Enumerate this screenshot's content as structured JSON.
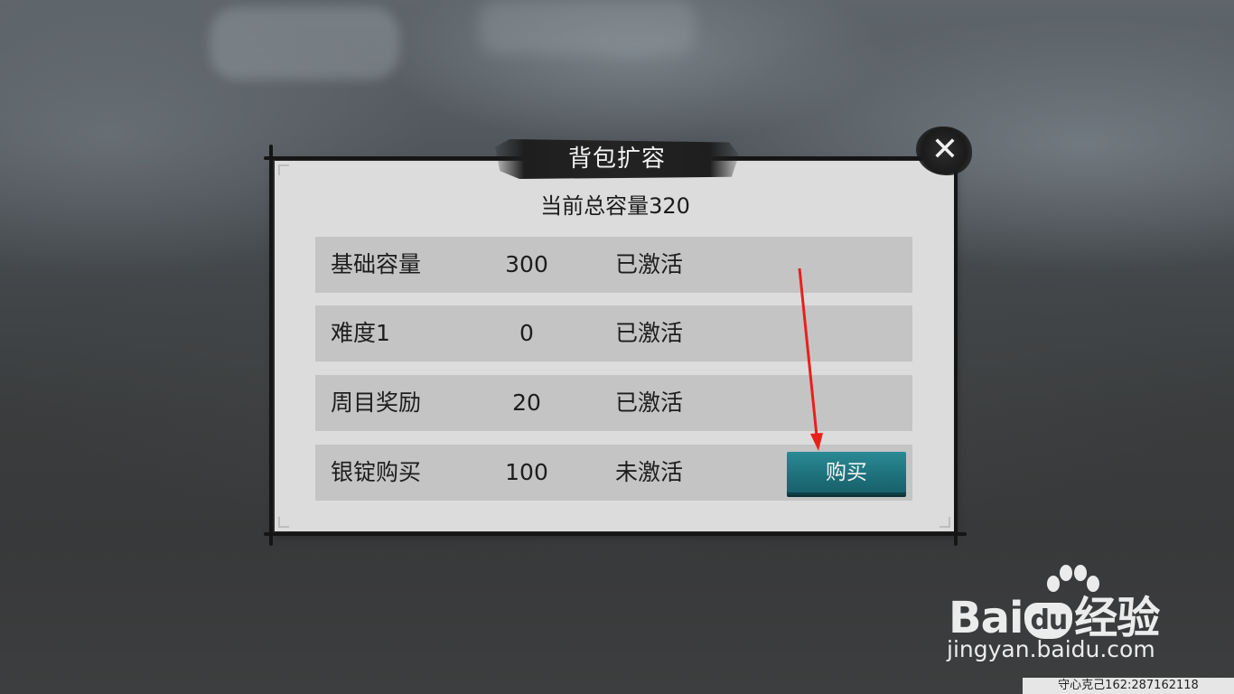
{
  "dialog": {
    "title": "背包扩容",
    "close_icon": "close-icon",
    "total_capacity": "当前总容量320",
    "rows": [
      {
        "name": "基础容量",
        "value": "300",
        "status": "已激活"
      },
      {
        "name": "难度1",
        "value": "0",
        "status": "已激活"
      },
      {
        "name": "周目奖励",
        "value": "20",
        "status": "已激活"
      },
      {
        "name": "银锭购买",
        "value": "100",
        "status": "未激活",
        "button": "购买"
      }
    ]
  },
  "watermark": {
    "brand_prefix": "Bai",
    "brand_mid": "du",
    "brand_suffix": "经验",
    "url": "jingyan.baidu.com",
    "credit": "守心克己162:287162118"
  },
  "colors": {
    "buy_button": "#1d6e79",
    "annotation_arrow": "#e8201c",
    "panel": "#dcdcdc",
    "row": "#c4c4c4"
  }
}
